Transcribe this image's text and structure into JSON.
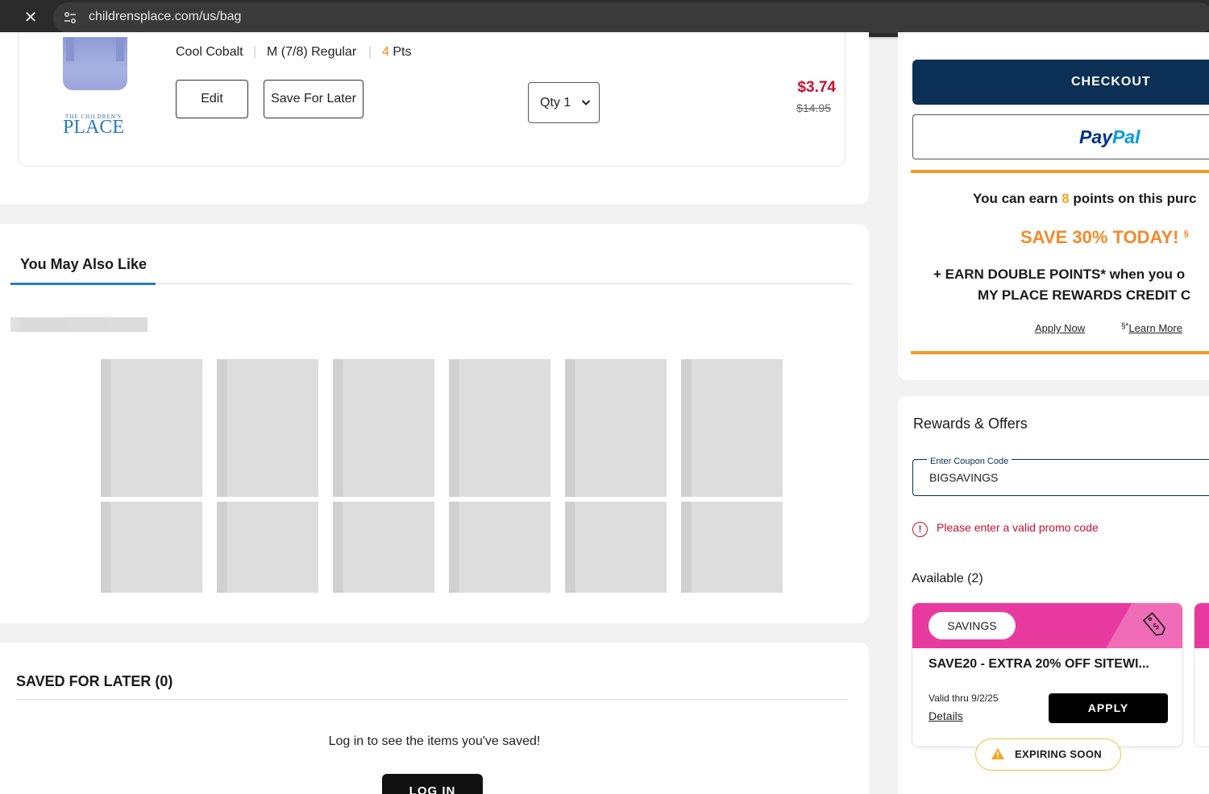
{
  "browser": {
    "url": "childrensplace.com/us/bag"
  },
  "cart_item": {
    "brand_small": "THE CHILDREN'S",
    "brand_big": "PLACE",
    "color": "Cool Cobalt",
    "size": "M (7/8) Regular",
    "points_num": "4",
    "points_label": "Pts",
    "edit_label": "Edit",
    "save_for_later_label": "Save For Later",
    "qty_label": "Qty 1",
    "sale_price": "$3.74",
    "original_price": "$14.95"
  },
  "you_may_also_like": {
    "tab_label": "You May Also Like"
  },
  "saved_for_later": {
    "title": "SAVED FOR LATER (0)",
    "message": "Log in to see the items you've saved!",
    "login_label": "LOG IN"
  },
  "summary": {
    "checkout_label": "CHECKOUT",
    "paypal_part1": "Pay",
    "paypal_part2": "Pal",
    "earn_prefix": "You can earn ",
    "earn_points": "8",
    "earn_suffix": " points on this purc",
    "save_today": "SAVE 30% TODAY!",
    "save_today_sup": "§",
    "double_line1": "+ EARN DOUBLE POINTS* when you o",
    "double_line2": "MY PLACE REWARDS CREDIT C",
    "apply_now": "Apply Now",
    "learn_more_prefix": "§*",
    "learn_more": "Learn More"
  },
  "rewards": {
    "title": "Rewards & Offers",
    "coupon_label": "Enter Coupon Code",
    "coupon_value": "BIGSAVINGS",
    "error_text": "Please enter a valid promo code",
    "available": "Available (2)",
    "offer": {
      "badge": "SAVINGS",
      "title": "SAVE20 - EXTRA 20% OFF SITEWI...",
      "valid": "Valid thru 9/2/25",
      "details": "Details",
      "apply_label": "APPLY",
      "expiring": "EXPIRING SOON"
    }
  },
  "colors": {
    "navy": "#0b2f55",
    "orange": "#f39a2b",
    "pink": "#e83a9e",
    "red": "#c8102e",
    "blue_accent": "#2a7bc4"
  }
}
